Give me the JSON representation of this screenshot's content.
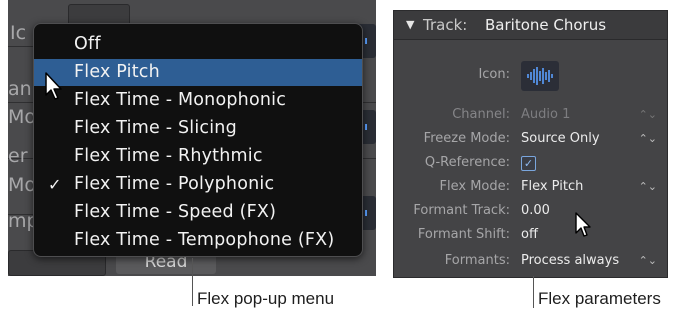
{
  "popup_menu": {
    "items": [
      {
        "label": "Off",
        "checked": false,
        "selected": false
      },
      {
        "label": "Flex Pitch",
        "checked": false,
        "selected": true
      },
      {
        "label": "Flex Time - Monophonic",
        "checked": false,
        "selected": false
      },
      {
        "label": "Flex Time - Slicing",
        "checked": false,
        "selected": false
      },
      {
        "label": "Flex Time - Rhythmic",
        "checked": false,
        "selected": false
      },
      {
        "label": "Flex Time - Polyphonic",
        "checked": true,
        "selected": false
      },
      {
        "label": "Flex Time - Speed (FX)",
        "checked": false,
        "selected": false
      },
      {
        "label": "Flex Time - Tempophone (FX)",
        "checked": false,
        "selected": false
      }
    ],
    "checkmark": "✓"
  },
  "background": {
    "cut_labels": [
      "Ic",
      "an",
      "Mo",
      "er",
      "Mo",
      "mp"
    ],
    "read_button": "Read"
  },
  "captions": {
    "left": "Flex pop-up menu",
    "right": "Flex parameters"
  },
  "inspector": {
    "header_label": "Track:",
    "header_value": "Baritone Chorus",
    "collapse_icon": "triangle-down-icon",
    "icon_label": "Icon:",
    "rows": [
      {
        "key": "Channel:",
        "value": "Audio 1",
        "dim": true,
        "chevron": true
      },
      {
        "key": "Freeze Mode:",
        "value": "Source Only",
        "dim": false,
        "chevron": true
      },
      {
        "key": "Q-Reference:",
        "value": "",
        "dim": false,
        "chevron": false
      },
      {
        "key": "Flex Mode:",
        "value": "Flex Pitch",
        "dim": false,
        "chevron": true
      },
      {
        "key": "Formant Track:",
        "value": "0.00",
        "dim": false,
        "chevron": false
      },
      {
        "key": "Formant Shift:",
        "value": "off",
        "dim": false,
        "chevron": false
      },
      {
        "key": "Formants:",
        "value": "Process always",
        "dim": false,
        "chevron": true
      }
    ],
    "q_reference_checked": true
  },
  "colors": {
    "menu_highlight": "#2e5e94",
    "menu_background": "#101010",
    "inspector_background": "#444446"
  }
}
